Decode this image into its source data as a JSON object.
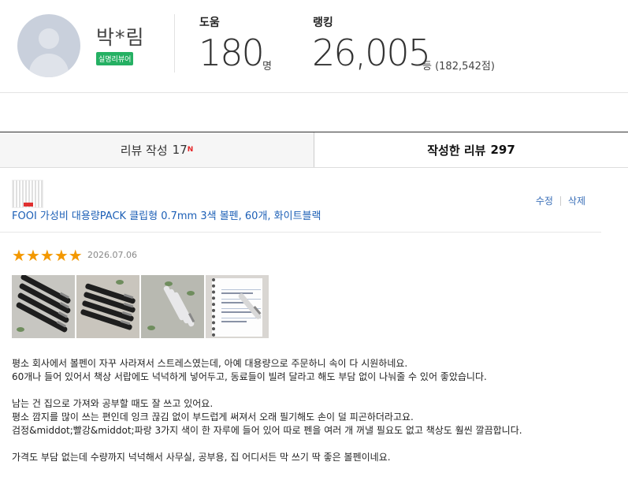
{
  "profile": {
    "nickname": "박*림",
    "badge": "실명리뷰어",
    "help_label": "도움",
    "help_count": "180",
    "help_unit": "명",
    "rank_label": "랭킹",
    "rank_value": "26,005",
    "rank_unit": "등 (182,542점)"
  },
  "tabs": {
    "write_label": "리뷰 작성",
    "write_count": "17",
    "write_new": "N",
    "written_label": "작성한 리뷰",
    "written_count": "297"
  },
  "product": {
    "title": "FOOI 가성비 대용량PACK 클립형 0.7mm 3색 볼펜, 60개, 화이트블랙",
    "edit_label": "수정",
    "delete_label": "삭제"
  },
  "review": {
    "rating": 5,
    "stars": [
      "★",
      "★",
      "★",
      "★",
      "★"
    ],
    "date": "2026.07.06",
    "photos": [
      "pens-photo-1",
      "pens-photo-2",
      "pens-photo-3",
      "notebook-writing-photo"
    ],
    "lines": [
      "평소 회사에서 볼펜이 자꾸 사라져서 스트레스였는데, 아예 대용량으로 주문하니 속이 다 시원하네요.",
      "60개나 들어 있어서 책상 서랍에도 넉넉하게 넣어두고, 동료들이 빌려 달라고 해도 부담 없이 나눠줄 수 있어 좋았습니다.",
      "",
      "남는 건 집으로 가져와 공부할 때도 잘 쓰고 있어요.",
      "평소 깜지를 많이 쓰는 편인데 잉크 끊김 없이 부드럽게 써져서 오래 필기해도 손이 덜 피곤하더라고요.",
      "검정&middot;빨강&middot;파랑 3가지 색이 한 자루에 들어 있어 따로 펜을 여러 개 꺼낼 필요도 없고 책상도 훨씬 깔끔합니다.",
      "",
      "가격도 부담 없는데 수량까지 넉넉해서 사무실, 공부용, 집 어디서든 막 쓰기 딱 좋은 볼펜이네요."
    ]
  },
  "colors": {
    "star": "#f39800",
    "link": "#1c5fb6",
    "badge": "#25b063",
    "new": "#e52528"
  }
}
